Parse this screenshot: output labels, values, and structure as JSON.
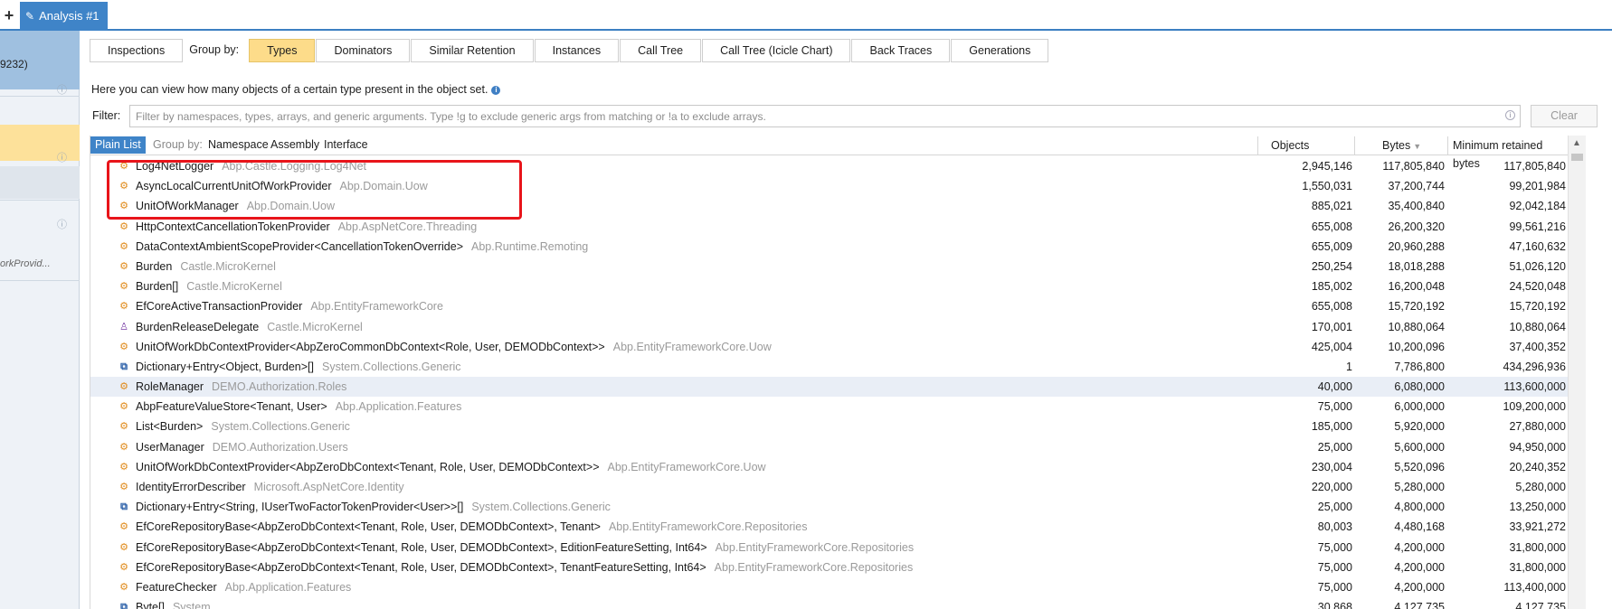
{
  "tabs": {
    "add_label": "+",
    "active_label": "Analysis #1"
  },
  "left_pane": {
    "pid_text": "9232)",
    "provider_text": "orkProvid..."
  },
  "view_tabs": {
    "inspections": "Inspections",
    "group_by_label": "Group by:",
    "types": "Types",
    "dominators": "Dominators",
    "similar_retention": "Similar Retention",
    "instances": "Instances",
    "call_tree": "Call Tree",
    "call_tree_icicle": "Call Tree (Icicle Chart)",
    "back_traces": "Back Traces",
    "generations": "Generations"
  },
  "hint": "Here you can view how many objects of a certain type present in the object set.",
  "filter": {
    "label": "Filter:",
    "placeholder": "Filter by namespaces, types, arrays, and generic arguments. Type !g to exclude generic args from matching or !a to exclude arrays.",
    "clear": "Clear"
  },
  "grid": {
    "plain_list": "Plain List",
    "group_by": "Group by:",
    "namespace": "Namespace",
    "assembly": "Assembly",
    "interface": "Interface",
    "col_objects": "Objects",
    "col_bytes": "Bytes",
    "col_retained": "Minimum retained bytes"
  },
  "colors": {
    "accent": "#3f84c8",
    "selected_tab": "#fddc8a",
    "highlight": "#e8141a"
  },
  "rows": [
    {
      "icon": "class-icon",
      "name": "Log4NetLogger",
      "ns": "Abp.Castle.Logging.Log4Net",
      "objects": "2,945,146",
      "bytes": "117,805,840",
      "retained": "117,805,840"
    },
    {
      "icon": "class-icon",
      "name": "AsyncLocalCurrentUnitOfWorkProvider",
      "ns": "Abp.Domain.Uow",
      "objects": "1,550,031",
      "bytes": "37,200,744",
      "retained": "99,201,984"
    },
    {
      "icon": "class-icon",
      "name": "UnitOfWorkManager",
      "ns": "Abp.Domain.Uow",
      "objects": "885,021",
      "bytes": "35,400,840",
      "retained": "92,042,184"
    },
    {
      "icon": "class-icon",
      "name": "HttpContextCancellationTokenProvider",
      "ns": "Abp.AspNetCore.Threading",
      "objects": "655,008",
      "bytes": "26,200,320",
      "retained": "99,561,216"
    },
    {
      "icon": "class-icon",
      "name": "DataContextAmbientScopeProvider<CancellationTokenOverride>",
      "ns": "Abp.Runtime.Remoting",
      "objects": "655,009",
      "bytes": "20,960,288",
      "retained": "47,160,632"
    },
    {
      "icon": "class-icon",
      "name": "Burden",
      "ns": "Castle.MicroKernel",
      "objects": "250,254",
      "bytes": "18,018,288",
      "retained": "51,026,120"
    },
    {
      "icon": "class-array-icon",
      "name": "Burden[]",
      "ns": "Castle.MicroKernel",
      "objects": "185,002",
      "bytes": "16,200,048",
      "retained": "24,520,048"
    },
    {
      "icon": "class-icon",
      "name": "EfCoreActiveTransactionProvider",
      "ns": "Abp.EntityFrameworkCore",
      "objects": "655,008",
      "bytes": "15,720,192",
      "retained": "15,720,192"
    },
    {
      "icon": "delegate-icon",
      "name": "BurdenReleaseDelegate",
      "ns": "Castle.MicroKernel",
      "objects": "170,001",
      "bytes": "10,880,064",
      "retained": "10,880,064"
    },
    {
      "icon": "class-icon",
      "name": "UnitOfWorkDbContextProvider<AbpZeroCommonDbContext<Role, User, DEMODbContext>>",
      "ns": "Abp.EntityFrameworkCore.Uow",
      "objects": "425,004",
      "bytes": "10,200,096",
      "retained": "37,400,352"
    },
    {
      "icon": "struct-array-icon",
      "name": "Dictionary+Entry<Object, Burden>[]",
      "ns": "System.Collections.Generic",
      "objects": "1",
      "bytes": "7,786,800",
      "retained": "434,296,936"
    },
    {
      "icon": "class-icon",
      "name": "RoleManager",
      "ns": "DEMO.Authorization.Roles",
      "objects": "40,000",
      "bytes": "6,080,000",
      "retained": "113,600,000",
      "hl": true
    },
    {
      "icon": "class-icon",
      "name": "AbpFeatureValueStore<Tenant, User>",
      "ns": "Abp.Application.Features",
      "objects": "75,000",
      "bytes": "6,000,000",
      "retained": "109,200,000"
    },
    {
      "icon": "class-icon",
      "name": "List<Burden>",
      "ns": "System.Collections.Generic",
      "objects": "185,000",
      "bytes": "5,920,000",
      "retained": "27,880,000"
    },
    {
      "icon": "class-icon",
      "name": "UserManager",
      "ns": "DEMO.Authorization.Users",
      "objects": "25,000",
      "bytes": "5,600,000",
      "retained": "94,950,000"
    },
    {
      "icon": "class-icon",
      "name": "UnitOfWorkDbContextProvider<AbpZeroDbContext<Tenant, Role, User, DEMODbContext>>",
      "ns": "Abp.EntityFrameworkCore.Uow",
      "objects": "230,004",
      "bytes": "5,520,096",
      "retained": "20,240,352"
    },
    {
      "icon": "class-icon",
      "name": "IdentityErrorDescriber",
      "ns": "Microsoft.AspNetCore.Identity",
      "objects": "220,000",
      "bytes": "5,280,000",
      "retained": "5,280,000"
    },
    {
      "icon": "struct-array-icon",
      "name": "Dictionary+Entry<String, IUserTwoFactorTokenProvider<User>>[]",
      "ns": "System.Collections.Generic",
      "objects": "25,000",
      "bytes": "4,800,000",
      "retained": "13,250,000"
    },
    {
      "icon": "class-icon",
      "name": "EfCoreRepositoryBase<AbpZeroDbContext<Tenant, Role, User, DEMODbContext>, Tenant>",
      "ns": "Abp.EntityFrameworkCore.Repositories",
      "objects": "80,003",
      "bytes": "4,480,168",
      "retained": "33,921,272"
    },
    {
      "icon": "class-icon",
      "name": "EfCoreRepositoryBase<AbpZeroDbContext<Tenant, Role, User, DEMODbContext>, EditionFeatureSetting, Int64>",
      "ns": "Abp.EntityFrameworkCore.Repositories",
      "objects": "75,000",
      "bytes": "4,200,000",
      "retained": "31,800,000"
    },
    {
      "icon": "class-icon",
      "name": "EfCoreRepositoryBase<AbpZeroDbContext<Tenant, Role, User, DEMODbContext>, TenantFeatureSetting, Int64>",
      "ns": "Abp.EntityFrameworkCore.Repositories",
      "objects": "75,000",
      "bytes": "4,200,000",
      "retained": "31,800,000"
    },
    {
      "icon": "class-icon",
      "name": "FeatureChecker",
      "ns": "Abp.Application.Features",
      "objects": "75,000",
      "bytes": "4,200,000",
      "retained": "113,400,000"
    },
    {
      "icon": "struct-array-icon",
      "name": "Byte[]",
      "ns": "System",
      "objects": "30,868",
      "bytes": "4,127,735",
      "retained": "4,127,735"
    }
  ]
}
